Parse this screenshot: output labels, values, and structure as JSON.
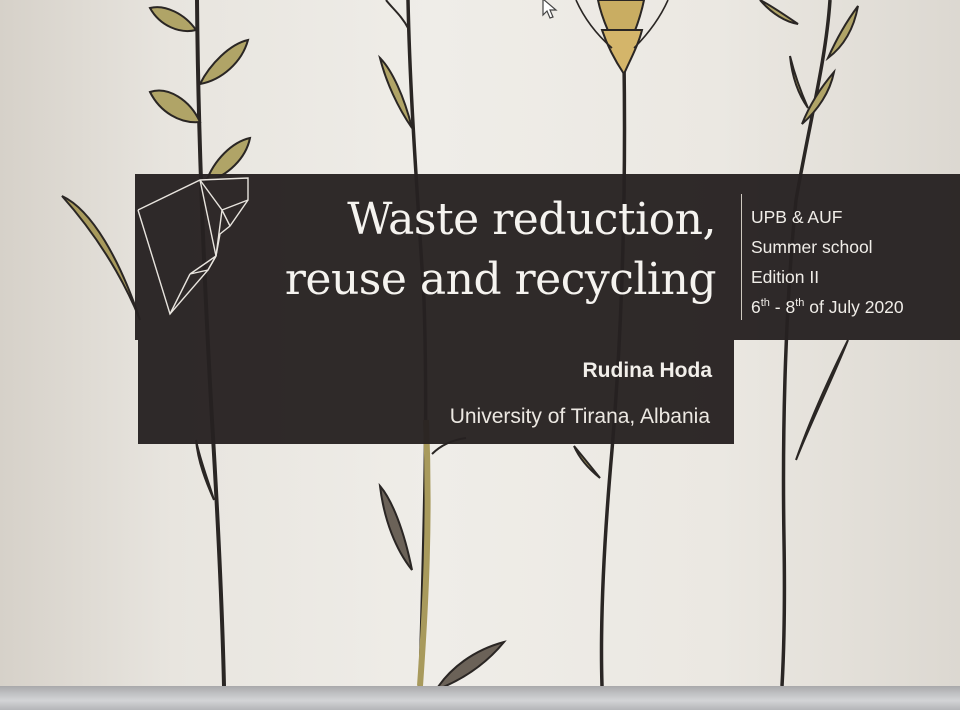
{
  "slide": {
    "title_line1": "Waste reduction,",
    "title_line2": "reuse and recycling",
    "author": "Rudina Hoda",
    "affiliation": "University of Tirana, Albania",
    "info": {
      "line1": "UPB & AUF",
      "line2": "Summer school",
      "line3": "Edition II",
      "date_start_num": "6",
      "date_start_sup": "th",
      "date_sep": " - 8",
      "date_end_sup": "th",
      "date_rest": " of July 2020"
    }
  },
  "colors": {
    "band": "#262121",
    "background": "#ece9e3",
    "stem_dark": "#2a2624",
    "stem_olive": "#a89a5c"
  },
  "icons": [
    "polygon-logo-icon",
    "mouse-cursor-icon",
    "wheat-plant-illustration"
  ]
}
